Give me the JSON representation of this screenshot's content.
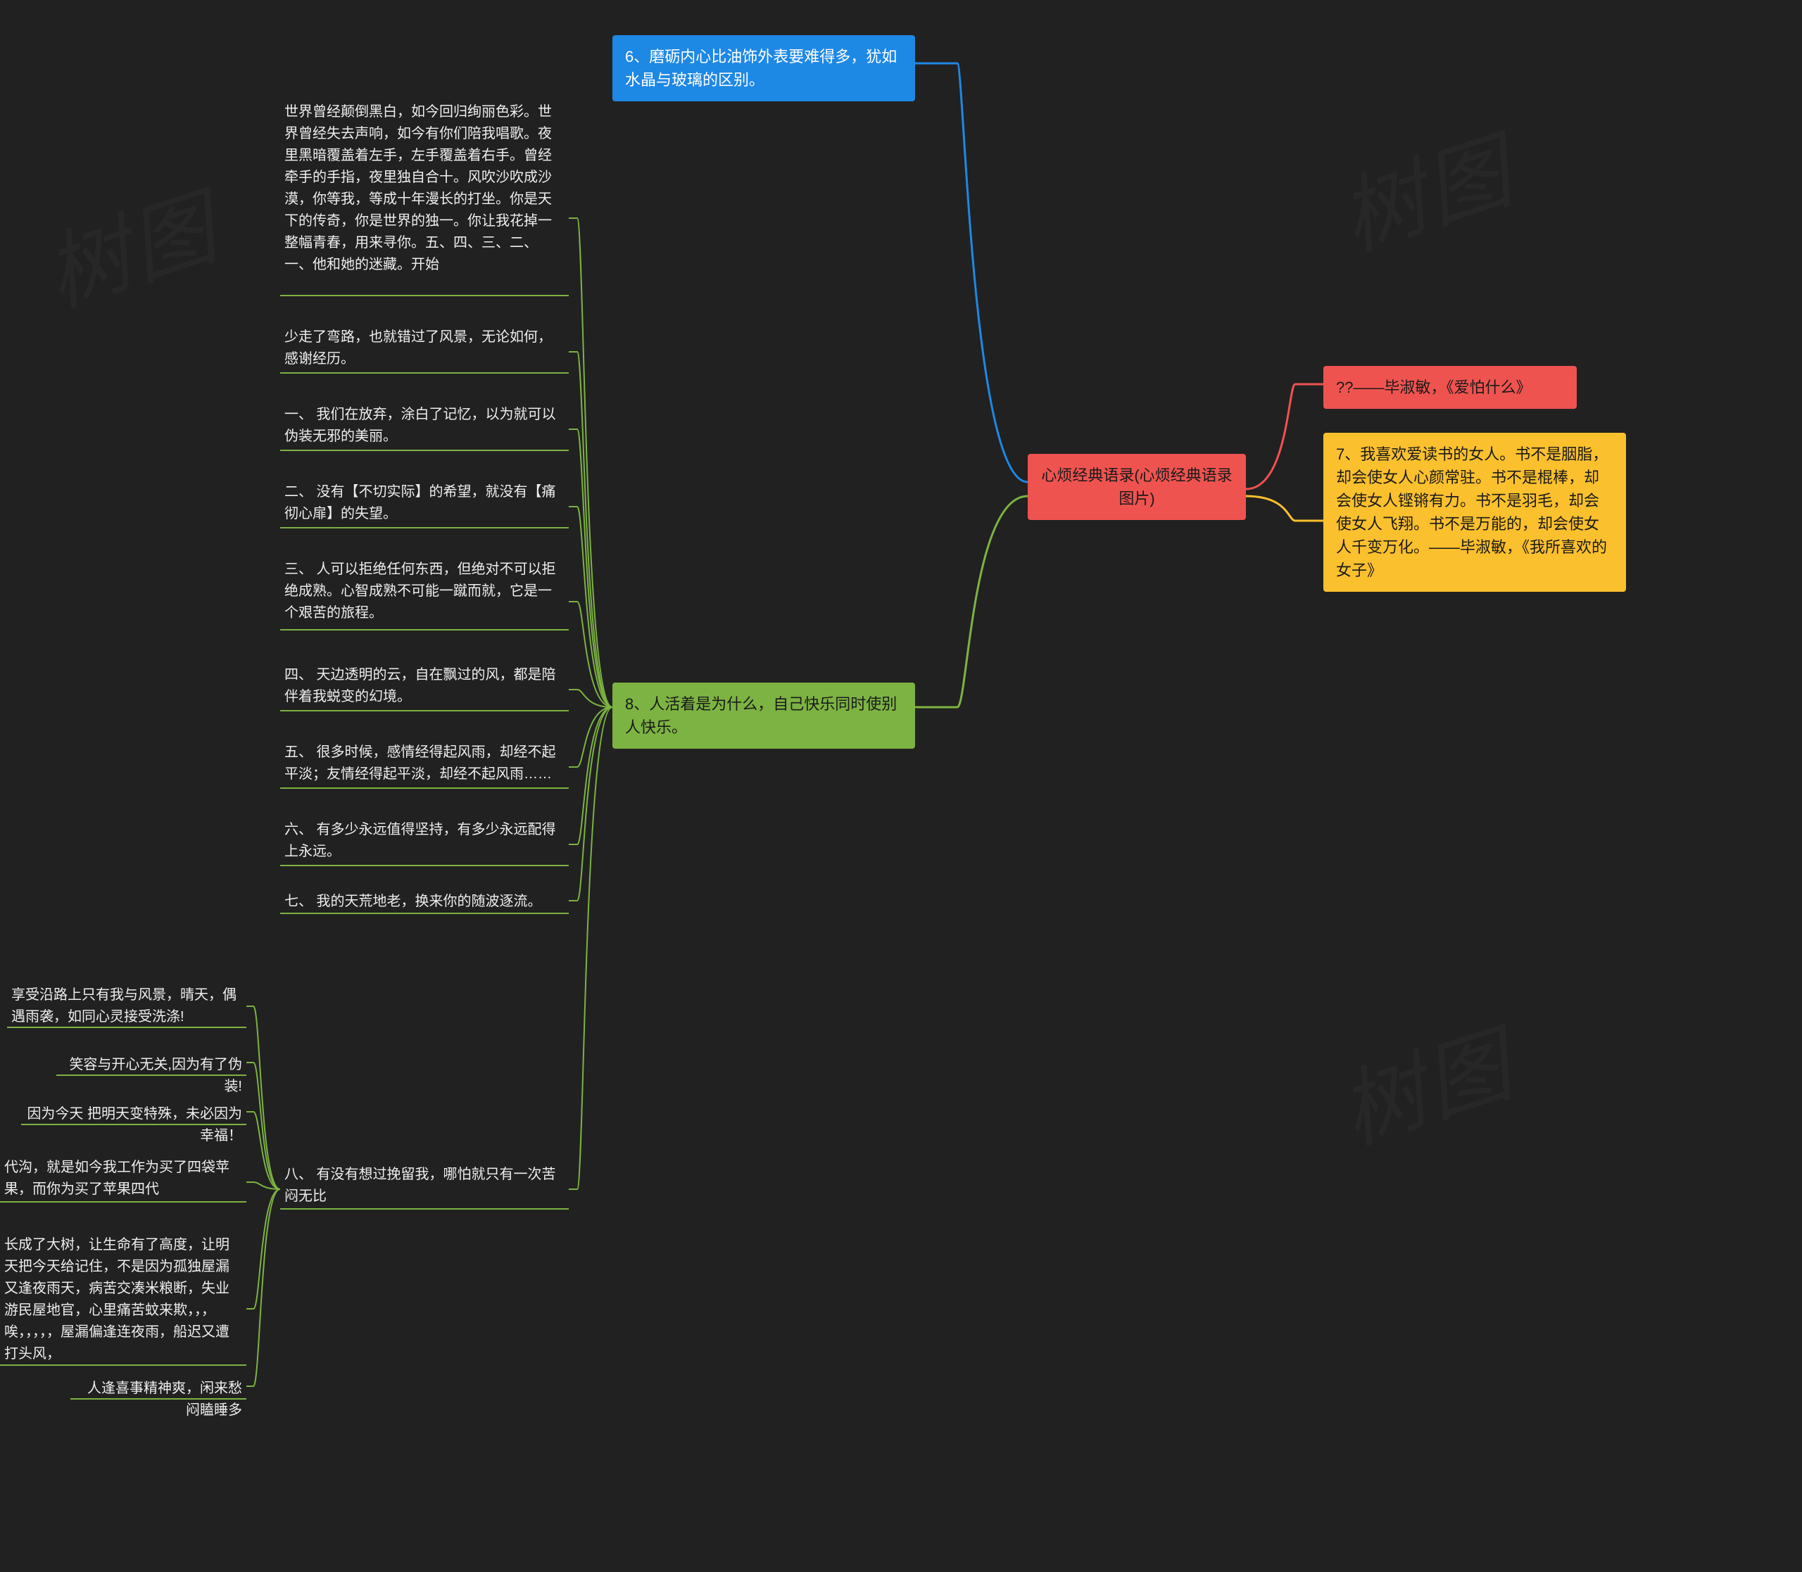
{
  "root": {
    "label": "心烦经典语录(心烦经典语录图片)"
  },
  "node6": {
    "label": "6、磨砺内心比油饰外表要难得多，犹如水晶与玻璃的区别。"
  },
  "node8": {
    "label": "8、人活着是为什么，自己快乐同时使别人快乐。"
  },
  "right1": {
    "label": "??——毕淑敏，《爱怕什么》"
  },
  "right2": {
    "label": "7、我喜欢爱读书的女人。书不是胭脂，却会使女人心颜常驻。书不是棍棒，却会使女人铿锵有力。书不是羽毛，却会使女人飞翔。书不是万能的，却会使女人千变万化。——毕淑敏，《我所喜欢的女子》"
  },
  "leafs8": [
    "世界曾经颠倒黑白，如今回归绚丽色彩。世界曾经失去声响，如今有你们陪我唱歌。夜里黑暗覆盖着左手，左手覆盖着右手。曾经牵手的手指，夜里独自合十。风吹沙吹成沙漠，你等我，等成十年漫长的打坐。你是天下的传奇，你是世界的独一。你让我花掉一整幅青春，用来寻你。五、四、三、二、一、他和她的迷藏。开始",
    "少走了弯路，也就错过了风景，无论如何，感谢经历。",
    "一、 我们在放弃，涂白了记忆，以为就可以伪装无邪的美丽。",
    "二、 没有【不切实际】的希望，就没有【痛彻心扉】的失望。",
    "三、 人可以拒绝任何东西，但绝对不可以拒绝成熟。心智成熟不可能一蹴而就，它是一个艰苦的旅程。",
    "四、 天边透明的云，自在飘过的风，都是陪伴着我蜕变的幻境。",
    "五、 很多时候，感情经得起风雨，却经不起平淡；友情经得起平淡，却经不起风雨……",
    "六、 有多少永远值得坚持，有多少永远配得上永远。",
    "七、 我的天荒地老，换来你的随波逐流。"
  ],
  "leafs8b": [
    "享受沿路上只有我与风景，晴天，偶遇雨袭，如同心灵接受洗涤!",
    "笑容与开心无关,因为有了伪装!",
    "因为今天 把明天变特殊，未必因为幸福！",
    "代沟，就是如今我工作为买了四袋苹果，而你为买了苹果四代",
    "长成了大树，让生命有了高度，让明天把今天给记住，不是因为孤独屋漏又逢夜雨天，病苦交凑米粮断，失业游民屋地官，心里痛苦蚊来欺，，，唉，，，，，屋漏偏逢连夜雨，船迟又遭打头风，",
    "人逢喜事精神爽，闲来愁闷瞌睡多"
  ],
  "leaf8b_title": "八、 有没有想过挽留我，哪怕就只有一次苦闷无比",
  "watermarks": [
    "树图",
    "树图",
    "树图"
  ]
}
